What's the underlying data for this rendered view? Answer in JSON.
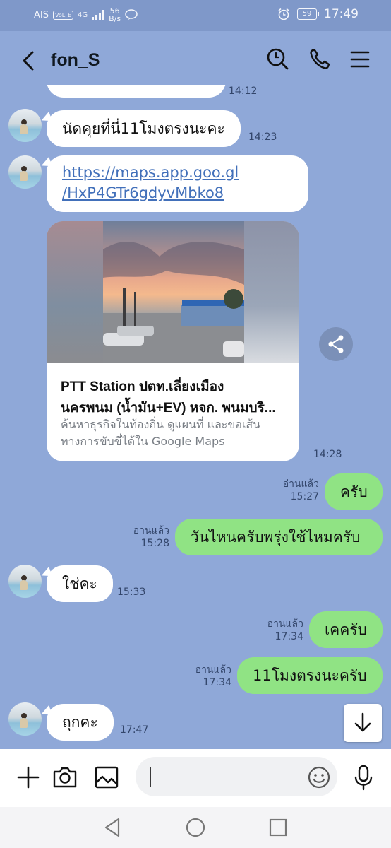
{
  "status_bar": {
    "carrier": "AIS",
    "volte": "VoLTE",
    "signal": "4G",
    "net_speed_value": "56",
    "net_speed_unit": "B/s",
    "battery": "59",
    "time": "17:49"
  },
  "header": {
    "contact_name": "fon_S"
  },
  "messages": [
    {
      "dir": "in",
      "text": "นัดคุยที่นี่11โมงตรงนะคะ",
      "time": "14:23"
    },
    {
      "dir": "in",
      "type": "link",
      "text": "https://maps.app.goo.gl/HxP4GTr6gdyvMbko8",
      "line1": "https://maps.app.goo.gl",
      "line2": "/HxP4GTr6gdyvMbko8"
    },
    {
      "dir": "in",
      "type": "map-preview",
      "title_line1": "PTT Station ปตท.เลี่ยงเมือง",
      "title_line2": "นครพนม (น้ำมัน+EV) หจก. พนมบริ...",
      "desc_line1": "ค้นหาธุรกิจในท้องถิ่น ดูแผนที่ และขอเส้น",
      "desc_line2": "ทางการขับขี่ได้ใน Google Maps",
      "time": "14:28"
    },
    {
      "dir": "out",
      "text": "ครับ",
      "read": "อ่านแล้ว",
      "time": "15:27"
    },
    {
      "dir": "out",
      "text": "วันไหนครับพรุ่งใช้ไหมครับ",
      "read": "อ่านแล้ว",
      "time": "15:28"
    },
    {
      "dir": "in",
      "text": "ใช่คะ",
      "time": "15:33"
    },
    {
      "dir": "out",
      "text": "เคครับ",
      "read": "อ่านแล้ว",
      "time": "17:34"
    },
    {
      "dir": "out",
      "text": "11โมงตรงนะครับ",
      "read": "อ่านแล้ว",
      "time": "17:34"
    },
    {
      "dir": "in",
      "text": "ถุกคะ",
      "time": "17:47"
    }
  ],
  "partial_time": "14:12",
  "input": {
    "value": "",
    "placeholder": ""
  },
  "colors": {
    "chat_bg": "#8fa8d8",
    "bubble_out": "#90e384",
    "bubble_in": "#ffffff",
    "link": "#4270ba"
  }
}
